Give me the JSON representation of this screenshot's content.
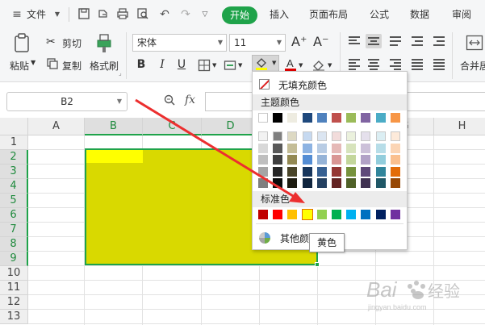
{
  "menubar": {
    "file_label": "文件",
    "tabs": [
      "开始",
      "插入",
      "页面布局",
      "公式",
      "数据",
      "审阅"
    ]
  },
  "ribbon": {
    "paste": "粘贴",
    "cut": "剪切",
    "copy": "复制",
    "format_painter": "格式刷",
    "font_name": "宋体",
    "font_size": "11",
    "merge_center": "合并居"
  },
  "formula_bar": {
    "name_box": "B2",
    "fx": "fx"
  },
  "grid": {
    "columns": [
      "A",
      "B",
      "C",
      "D",
      "E",
      "F",
      "G",
      "H"
    ],
    "rows": [
      "1",
      "2",
      "3",
      "4",
      "5",
      "6",
      "7",
      "8",
      "9",
      "10",
      "11",
      "12",
      "13"
    ],
    "selected_columns": [
      "B",
      "C",
      "D",
      "E"
    ],
    "selected_rows": [
      "2",
      "3",
      "4",
      "5",
      "6",
      "7",
      "8",
      "9"
    ],
    "fill_color": "#d9d900",
    "active_cell_color": "#ffff00"
  },
  "palette": {
    "no_fill": "无填充颜色",
    "theme_colors_title": "主题颜色",
    "theme_top_row": [
      "#ffffff",
      "#000000",
      "#eeece1",
      "#1f497d",
      "#4f81bd",
      "#c0504d",
      "#9bbb59",
      "#8064a2",
      "#4bacc6",
      "#f79646"
    ],
    "theme_shades": [
      [
        "#f2f2f2",
        "#7f7f7f",
        "#ddd9c3",
        "#c6d9f0",
        "#dbe5f1",
        "#f2dcdb",
        "#ebf1dd",
        "#e5e0ec",
        "#dbeef3",
        "#fdeada"
      ],
      [
        "#d8d8d8",
        "#595959",
        "#c4bd97",
        "#8db3e2",
        "#b8cce4",
        "#e5b9b7",
        "#d7e3bc",
        "#ccc1d9",
        "#b7dde8",
        "#fbd5b5"
      ],
      [
        "#bfbfbf",
        "#3f3f3f",
        "#938953",
        "#548dd4",
        "#95b3d7",
        "#d99694",
        "#c3d69b",
        "#b2a2c7",
        "#92cddc",
        "#fac08f"
      ],
      [
        "#a5a5a5",
        "#262626",
        "#494429",
        "#17365d",
        "#366092",
        "#953734",
        "#76923c",
        "#5f497a",
        "#31859b",
        "#e36c09"
      ],
      [
        "#7f7f7f",
        "#0c0c0c",
        "#1d1b10",
        "#0f243e",
        "#244061",
        "#632423",
        "#4f6128",
        "#3f3151",
        "#205867",
        "#974806"
      ]
    ],
    "standard_title": "标准色",
    "standard_colors": [
      "#c00000",
      "#ff0000",
      "#ffc000",
      "#ffff00",
      "#92d050",
      "#00b050",
      "#00b0f0",
      "#0070c0",
      "#002060",
      "#7030a0"
    ],
    "more_colors": "其他颜色",
    "hovered_color_name": "黄色"
  }
}
